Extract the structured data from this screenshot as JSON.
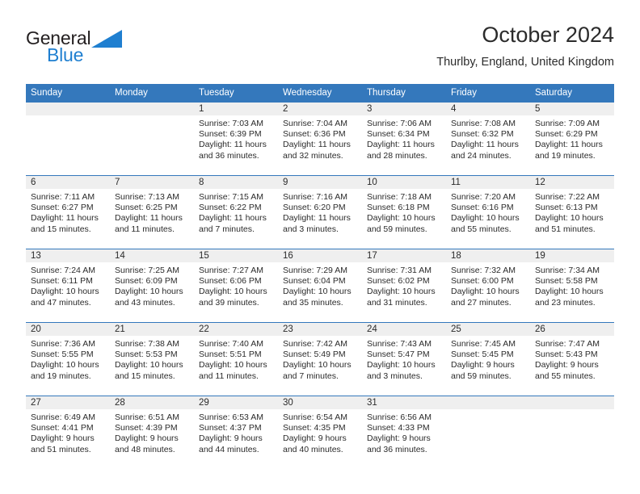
{
  "brand": {
    "name_part1": "General",
    "name_part2": "Blue",
    "triangle_color": "#1f7fd0",
    "text_color": "#231f20",
    "blue_color": "#1f7fd0"
  },
  "header": {
    "title": "October 2024",
    "subtitle": "Thurlby, England, United Kingdom"
  },
  "theme": {
    "header_bg": "#3478bc",
    "header_text": "#ffffff",
    "daynum_bg": "#efefef",
    "body_text": "#2b2b2b",
    "row_divider": "#3478bc"
  },
  "weekdays": [
    "Sunday",
    "Monday",
    "Tuesday",
    "Wednesday",
    "Thursday",
    "Friday",
    "Saturday"
  ],
  "weeks": [
    [
      {
        "day": "",
        "sunrise": "",
        "sunset": "",
        "daylight1": "",
        "daylight2": ""
      },
      {
        "day": "",
        "sunrise": "",
        "sunset": "",
        "daylight1": "",
        "daylight2": ""
      },
      {
        "day": "1",
        "sunrise": "Sunrise: 7:03 AM",
        "sunset": "Sunset: 6:39 PM",
        "daylight1": "Daylight: 11 hours",
        "daylight2": "and 36 minutes."
      },
      {
        "day": "2",
        "sunrise": "Sunrise: 7:04 AM",
        "sunset": "Sunset: 6:36 PM",
        "daylight1": "Daylight: 11 hours",
        "daylight2": "and 32 minutes."
      },
      {
        "day": "3",
        "sunrise": "Sunrise: 7:06 AM",
        "sunset": "Sunset: 6:34 PM",
        "daylight1": "Daylight: 11 hours",
        "daylight2": "and 28 minutes."
      },
      {
        "day": "4",
        "sunrise": "Sunrise: 7:08 AM",
        "sunset": "Sunset: 6:32 PM",
        "daylight1": "Daylight: 11 hours",
        "daylight2": "and 24 minutes."
      },
      {
        "day": "5",
        "sunrise": "Sunrise: 7:09 AM",
        "sunset": "Sunset: 6:29 PM",
        "daylight1": "Daylight: 11 hours",
        "daylight2": "and 19 minutes."
      }
    ],
    [
      {
        "day": "6",
        "sunrise": "Sunrise: 7:11 AM",
        "sunset": "Sunset: 6:27 PM",
        "daylight1": "Daylight: 11 hours",
        "daylight2": "and 15 minutes."
      },
      {
        "day": "7",
        "sunrise": "Sunrise: 7:13 AM",
        "sunset": "Sunset: 6:25 PM",
        "daylight1": "Daylight: 11 hours",
        "daylight2": "and 11 minutes."
      },
      {
        "day": "8",
        "sunrise": "Sunrise: 7:15 AM",
        "sunset": "Sunset: 6:22 PM",
        "daylight1": "Daylight: 11 hours",
        "daylight2": "and 7 minutes."
      },
      {
        "day": "9",
        "sunrise": "Sunrise: 7:16 AM",
        "sunset": "Sunset: 6:20 PM",
        "daylight1": "Daylight: 11 hours",
        "daylight2": "and 3 minutes."
      },
      {
        "day": "10",
        "sunrise": "Sunrise: 7:18 AM",
        "sunset": "Sunset: 6:18 PM",
        "daylight1": "Daylight: 10 hours",
        "daylight2": "and 59 minutes."
      },
      {
        "day": "11",
        "sunrise": "Sunrise: 7:20 AM",
        "sunset": "Sunset: 6:16 PM",
        "daylight1": "Daylight: 10 hours",
        "daylight2": "and 55 minutes."
      },
      {
        "day": "12",
        "sunrise": "Sunrise: 7:22 AM",
        "sunset": "Sunset: 6:13 PM",
        "daylight1": "Daylight: 10 hours",
        "daylight2": "and 51 minutes."
      }
    ],
    [
      {
        "day": "13",
        "sunrise": "Sunrise: 7:24 AM",
        "sunset": "Sunset: 6:11 PM",
        "daylight1": "Daylight: 10 hours",
        "daylight2": "and 47 minutes."
      },
      {
        "day": "14",
        "sunrise": "Sunrise: 7:25 AM",
        "sunset": "Sunset: 6:09 PM",
        "daylight1": "Daylight: 10 hours",
        "daylight2": "and 43 minutes."
      },
      {
        "day": "15",
        "sunrise": "Sunrise: 7:27 AM",
        "sunset": "Sunset: 6:06 PM",
        "daylight1": "Daylight: 10 hours",
        "daylight2": "and 39 minutes."
      },
      {
        "day": "16",
        "sunrise": "Sunrise: 7:29 AM",
        "sunset": "Sunset: 6:04 PM",
        "daylight1": "Daylight: 10 hours",
        "daylight2": "and 35 minutes."
      },
      {
        "day": "17",
        "sunrise": "Sunrise: 7:31 AM",
        "sunset": "Sunset: 6:02 PM",
        "daylight1": "Daylight: 10 hours",
        "daylight2": "and 31 minutes."
      },
      {
        "day": "18",
        "sunrise": "Sunrise: 7:32 AM",
        "sunset": "Sunset: 6:00 PM",
        "daylight1": "Daylight: 10 hours",
        "daylight2": "and 27 minutes."
      },
      {
        "day": "19",
        "sunrise": "Sunrise: 7:34 AM",
        "sunset": "Sunset: 5:58 PM",
        "daylight1": "Daylight: 10 hours",
        "daylight2": "and 23 minutes."
      }
    ],
    [
      {
        "day": "20",
        "sunrise": "Sunrise: 7:36 AM",
        "sunset": "Sunset: 5:55 PM",
        "daylight1": "Daylight: 10 hours",
        "daylight2": "and 19 minutes."
      },
      {
        "day": "21",
        "sunrise": "Sunrise: 7:38 AM",
        "sunset": "Sunset: 5:53 PM",
        "daylight1": "Daylight: 10 hours",
        "daylight2": "and 15 minutes."
      },
      {
        "day": "22",
        "sunrise": "Sunrise: 7:40 AM",
        "sunset": "Sunset: 5:51 PM",
        "daylight1": "Daylight: 10 hours",
        "daylight2": "and 11 minutes."
      },
      {
        "day": "23",
        "sunrise": "Sunrise: 7:42 AM",
        "sunset": "Sunset: 5:49 PM",
        "daylight1": "Daylight: 10 hours",
        "daylight2": "and 7 minutes."
      },
      {
        "day": "24",
        "sunrise": "Sunrise: 7:43 AM",
        "sunset": "Sunset: 5:47 PM",
        "daylight1": "Daylight: 10 hours",
        "daylight2": "and 3 minutes."
      },
      {
        "day": "25",
        "sunrise": "Sunrise: 7:45 AM",
        "sunset": "Sunset: 5:45 PM",
        "daylight1": "Daylight: 9 hours",
        "daylight2": "and 59 minutes."
      },
      {
        "day": "26",
        "sunrise": "Sunrise: 7:47 AM",
        "sunset": "Sunset: 5:43 PM",
        "daylight1": "Daylight: 9 hours",
        "daylight2": "and 55 minutes."
      }
    ],
    [
      {
        "day": "27",
        "sunrise": "Sunrise: 6:49 AM",
        "sunset": "Sunset: 4:41 PM",
        "daylight1": "Daylight: 9 hours",
        "daylight2": "and 51 minutes."
      },
      {
        "day": "28",
        "sunrise": "Sunrise: 6:51 AM",
        "sunset": "Sunset: 4:39 PM",
        "daylight1": "Daylight: 9 hours",
        "daylight2": "and 48 minutes."
      },
      {
        "day": "29",
        "sunrise": "Sunrise: 6:53 AM",
        "sunset": "Sunset: 4:37 PM",
        "daylight1": "Daylight: 9 hours",
        "daylight2": "and 44 minutes."
      },
      {
        "day": "30",
        "sunrise": "Sunrise: 6:54 AM",
        "sunset": "Sunset: 4:35 PM",
        "daylight1": "Daylight: 9 hours",
        "daylight2": "and 40 minutes."
      },
      {
        "day": "31",
        "sunrise": "Sunrise: 6:56 AM",
        "sunset": "Sunset: 4:33 PM",
        "daylight1": "Daylight: 9 hours",
        "daylight2": "and 36 minutes."
      },
      {
        "day": "",
        "sunrise": "",
        "sunset": "",
        "daylight1": "",
        "daylight2": ""
      },
      {
        "day": "",
        "sunrise": "",
        "sunset": "",
        "daylight1": "",
        "daylight2": ""
      }
    ]
  ]
}
